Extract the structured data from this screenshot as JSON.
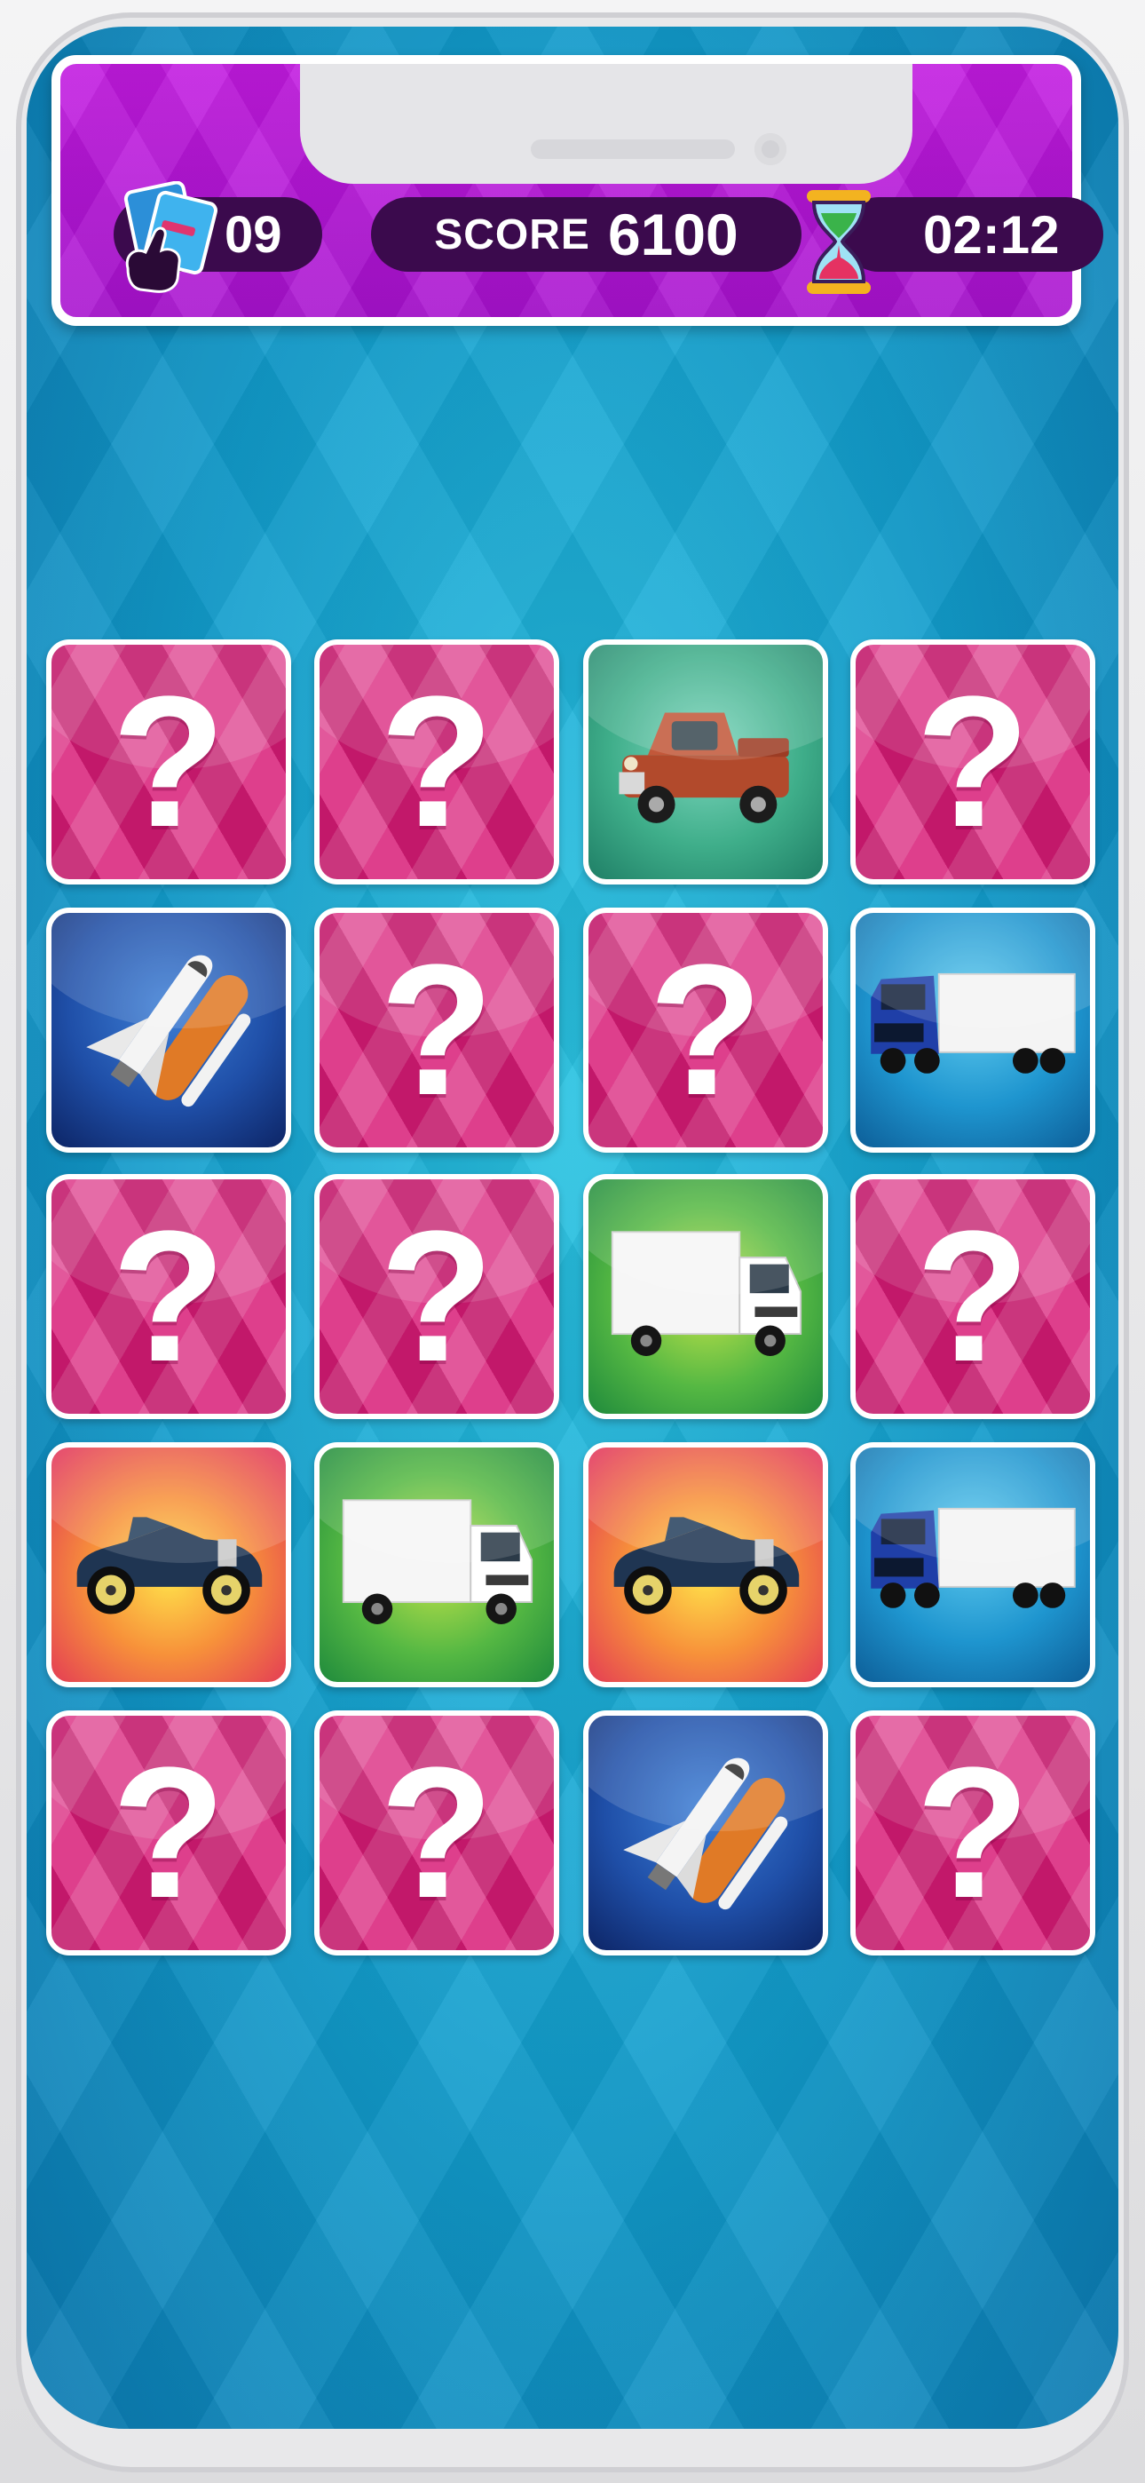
{
  "header": {
    "moves_value": "09",
    "score_label": "SCORE",
    "score_value": "6100",
    "timer_value": "02:12"
  },
  "board": {
    "columns": 4,
    "rows": 5,
    "cards": [
      {
        "state": "hidden",
        "symbol": "?"
      },
      {
        "state": "hidden",
        "symbol": "?"
      },
      {
        "state": "revealed",
        "image": "vintage-pickup-truck",
        "bg": "teal-green"
      },
      {
        "state": "hidden",
        "symbol": "?"
      },
      {
        "state": "revealed",
        "image": "space-shuttle",
        "bg": "blue"
      },
      {
        "state": "hidden",
        "symbol": "?"
      },
      {
        "state": "hidden",
        "symbol": "?"
      },
      {
        "state": "revealed",
        "image": "blue-semi-truck",
        "bg": "cyan"
      },
      {
        "state": "hidden",
        "symbol": "?"
      },
      {
        "state": "hidden",
        "symbol": "?"
      },
      {
        "state": "revealed",
        "image": "white-box-truck",
        "bg": "green"
      },
      {
        "state": "hidden",
        "symbol": "?"
      },
      {
        "state": "revealed",
        "image": "vintage-convertible-car",
        "bg": "red-yellow"
      },
      {
        "state": "revealed",
        "image": "white-box-truck",
        "bg": "green"
      },
      {
        "state": "revealed",
        "image": "vintage-convertible-car",
        "bg": "red-yellow"
      },
      {
        "state": "revealed",
        "image": "blue-semi-truck",
        "bg": "cyan"
      },
      {
        "state": "hidden",
        "symbol": "?"
      },
      {
        "state": "hidden",
        "symbol": "?"
      },
      {
        "state": "revealed",
        "image": "space-shuttle",
        "bg": "blue"
      },
      {
        "state": "hidden",
        "symbol": "?"
      }
    ]
  },
  "colors": {
    "header_purple": "#b516d8",
    "pill_dark": "#3b0a4d",
    "card_back_pink": "#c2186a",
    "board_cyan": "#1aa9d6"
  }
}
